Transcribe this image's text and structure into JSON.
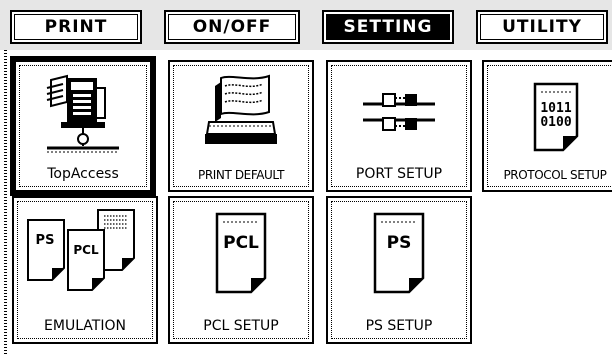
{
  "tabs": [
    {
      "label": "PRINT",
      "active": false
    },
    {
      "label": "ON/OFF",
      "active": false
    },
    {
      "label": "SETTING",
      "active": true
    },
    {
      "label": "UTILITY",
      "active": false
    }
  ],
  "tiles": {
    "topaccess": {
      "label": "TopAccess",
      "icon": "printer-network-icon"
    },
    "print_default": {
      "label": "PRINT DEFAULT",
      "icon": "paper-tray-icon"
    },
    "port_setup": {
      "label": "PORT SETUP",
      "icon": "port-connectors-icon"
    },
    "protocol_setup": {
      "label": "PROTOCOL SETUP",
      "icon": "binary-document-icon"
    },
    "emulation": {
      "label": "EMULATION",
      "icon": "stacked-documents-icon"
    },
    "pcl_setup": {
      "label": "PCL SETUP",
      "icon": "pcl-document-icon"
    },
    "ps_setup": {
      "label": "PS SETUP",
      "icon": "ps-document-icon"
    }
  },
  "icon_text": {
    "ps": "PS",
    "pcl": "PCL",
    "binary_line1": "1011",
    "binary_line2": "0100"
  },
  "colors": {
    "foreground": "#000000",
    "background": "#ffffff"
  }
}
